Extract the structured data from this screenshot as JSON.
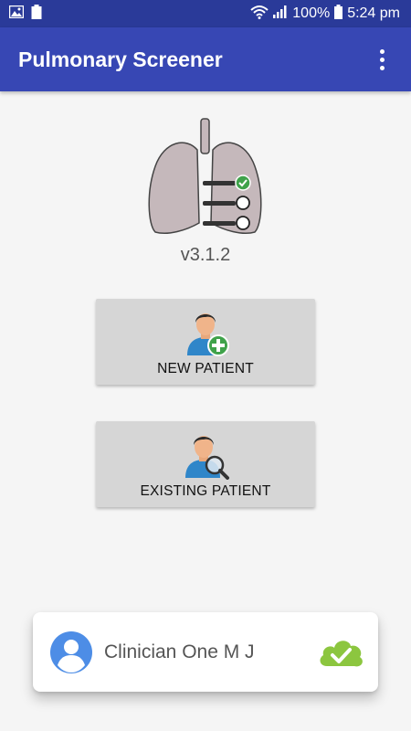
{
  "status_bar": {
    "battery_percent": "100%",
    "time": "5:24 pm"
  },
  "app_bar": {
    "title": "Pulmonary Screener"
  },
  "logo": {
    "version": "v3.1.2"
  },
  "actions": {
    "new_patient_label": "NEW PATIENT",
    "existing_patient_label": "EXISTING PATIENT"
  },
  "user_card": {
    "clinician_name": "Clinician One M J"
  },
  "colors": {
    "status_bar": "#2a3a99",
    "app_bar": "#3747b4",
    "button_bg": "#d6d6d6",
    "plus_badge": "#3fa24a",
    "sync_cloud": "#8cc63f",
    "avatar_blue": "#4d8de6"
  }
}
